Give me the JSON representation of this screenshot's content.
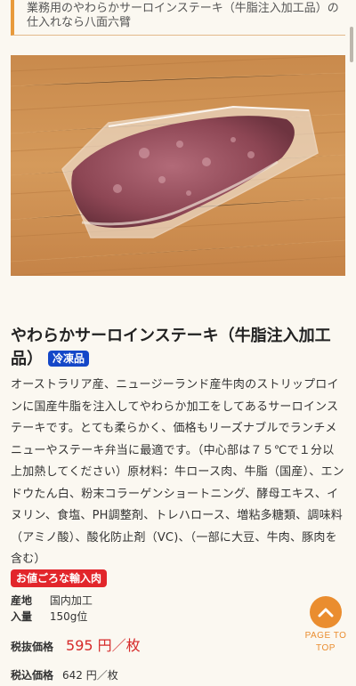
{
  "header": {
    "text": "業務用のやわらかサーロインステーキ（牛脂注入加工品）の仕入れなら八面六臂"
  },
  "product": {
    "title": "やわらかサーロインステーキ（牛脂注入加工品）",
    "badge": "冷凍品",
    "description": "オーストラリア産、ニュージーランド産牛肉のストリップロインに国産牛脂を注入してやわらか加工をしてあるサーロインステーキです。とても柔らかく、価格もリーズナブルでランチメニューやステーキ弁当に最適です。（中心部は７５℃で１分以上加熱してください）原材料：牛ロース肉、牛脂（国産）、エンドウたん白、粉末コラーゲンショートニング、酵母エキス、イヌリン、食塩、PH調整剤、トレハロース、増粘多糖類、調味料（アミノ酸）、酸化防止剤（VC)、（一部に大豆、牛肉、豚肉を含む）",
    "tag": "お値ごろな輸入肉",
    "specs": [
      {
        "key": "産地",
        "value": "国内加工"
      },
      {
        "key": "入量",
        "value": "150g位"
      }
    ],
    "price_label": "税抜価格",
    "price": "595 円／枚",
    "tax_label": "税込価格",
    "tax_price": "642 円／枚"
  },
  "page_top": {
    "line1": "PAGE TO",
    "line2": "TOP",
    "icon": "chevron-up-icon"
  },
  "colors": {
    "accent": "#ea8d2f",
    "price": "#d62a2a",
    "frozen_badge": "#1447c8",
    "tag_badge": "#e2262b"
  }
}
